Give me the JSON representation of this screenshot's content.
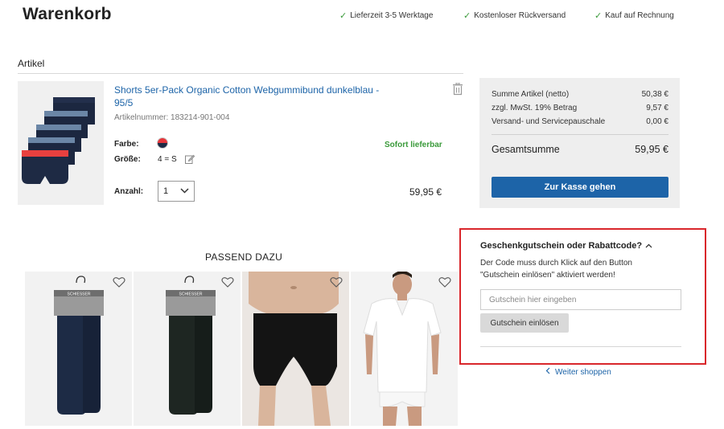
{
  "header": {
    "title": "Warenkorb",
    "usps": [
      "Lieferzeit 3-5 Werktage",
      "Kostenloser Rückversand",
      "Kauf auf Rechnung"
    ]
  },
  "cart": {
    "section_label": "Artikel",
    "item": {
      "title": "Shorts 5er-Pack Organic Cotton Webgummibund dunkelblau - 95/5",
      "article_number": "Artikelnummer: 183214-901-004",
      "color_label": "Farbe:",
      "size_label": "Größe:",
      "size_value": "4 = S",
      "availability": "Sofort lieferbar",
      "quantity_label": "Anzahl:",
      "quantity_value": "1",
      "price": "59,95 €"
    }
  },
  "summary": {
    "rows": [
      {
        "label": "Summe Artikel (netto)",
        "value": "50,38 €"
      },
      {
        "label": "zzgl. MwSt. 19% Betrag",
        "value": "9,57 €"
      },
      {
        "label": "Versand- und Servicepauschale",
        "value": "0,00 €"
      }
    ],
    "total_label": "Gesamtsumme",
    "total_value": "59,95 €",
    "checkout_label": "Zur Kasse gehen"
  },
  "coupon": {
    "title": "Geschenkgutschein oder Rabattcode?",
    "description": "Der Code muss durch Klick auf den Button \"Gutschein einlösen\" aktiviert werden!",
    "placeholder": "Gutschein hier eingeben",
    "button_label": "Gutschein einlösen"
  },
  "continue_label": "Weiter shoppen",
  "recommendations": {
    "title": "PASSEND DAZU",
    "brand": "SCHIESSER"
  },
  "colors": {
    "accent": "#1d64a8",
    "stock": "#3a9a3a",
    "highlight_border": "#d9262b"
  }
}
